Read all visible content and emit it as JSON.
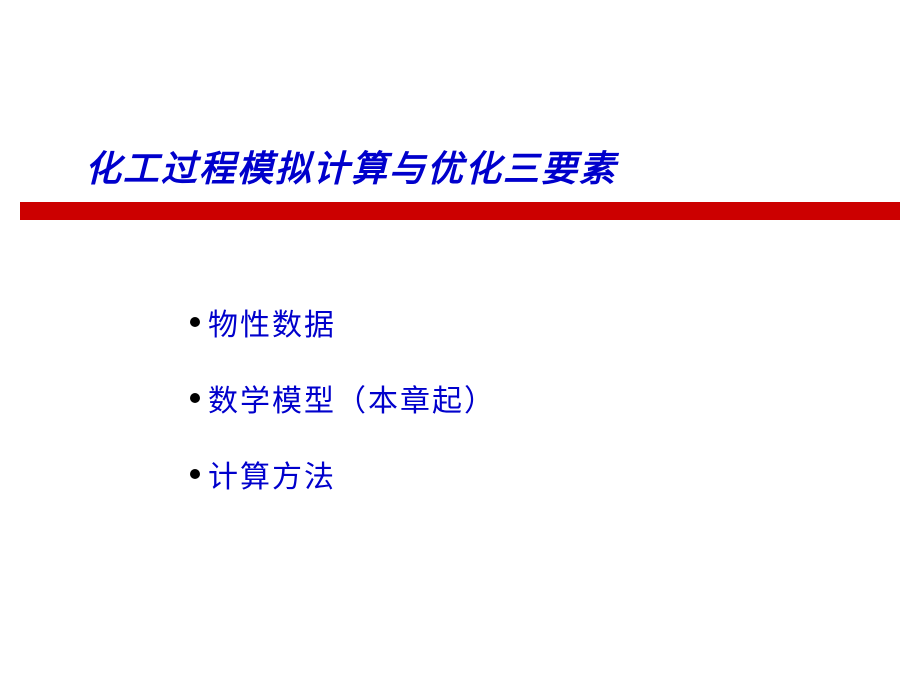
{
  "slide": {
    "title": "化工过程模拟计算与优化三要素",
    "items": [
      {
        "text": "物性数据"
      },
      {
        "text": "数学模型（本章起）"
      },
      {
        "text": "计算方法"
      }
    ]
  }
}
